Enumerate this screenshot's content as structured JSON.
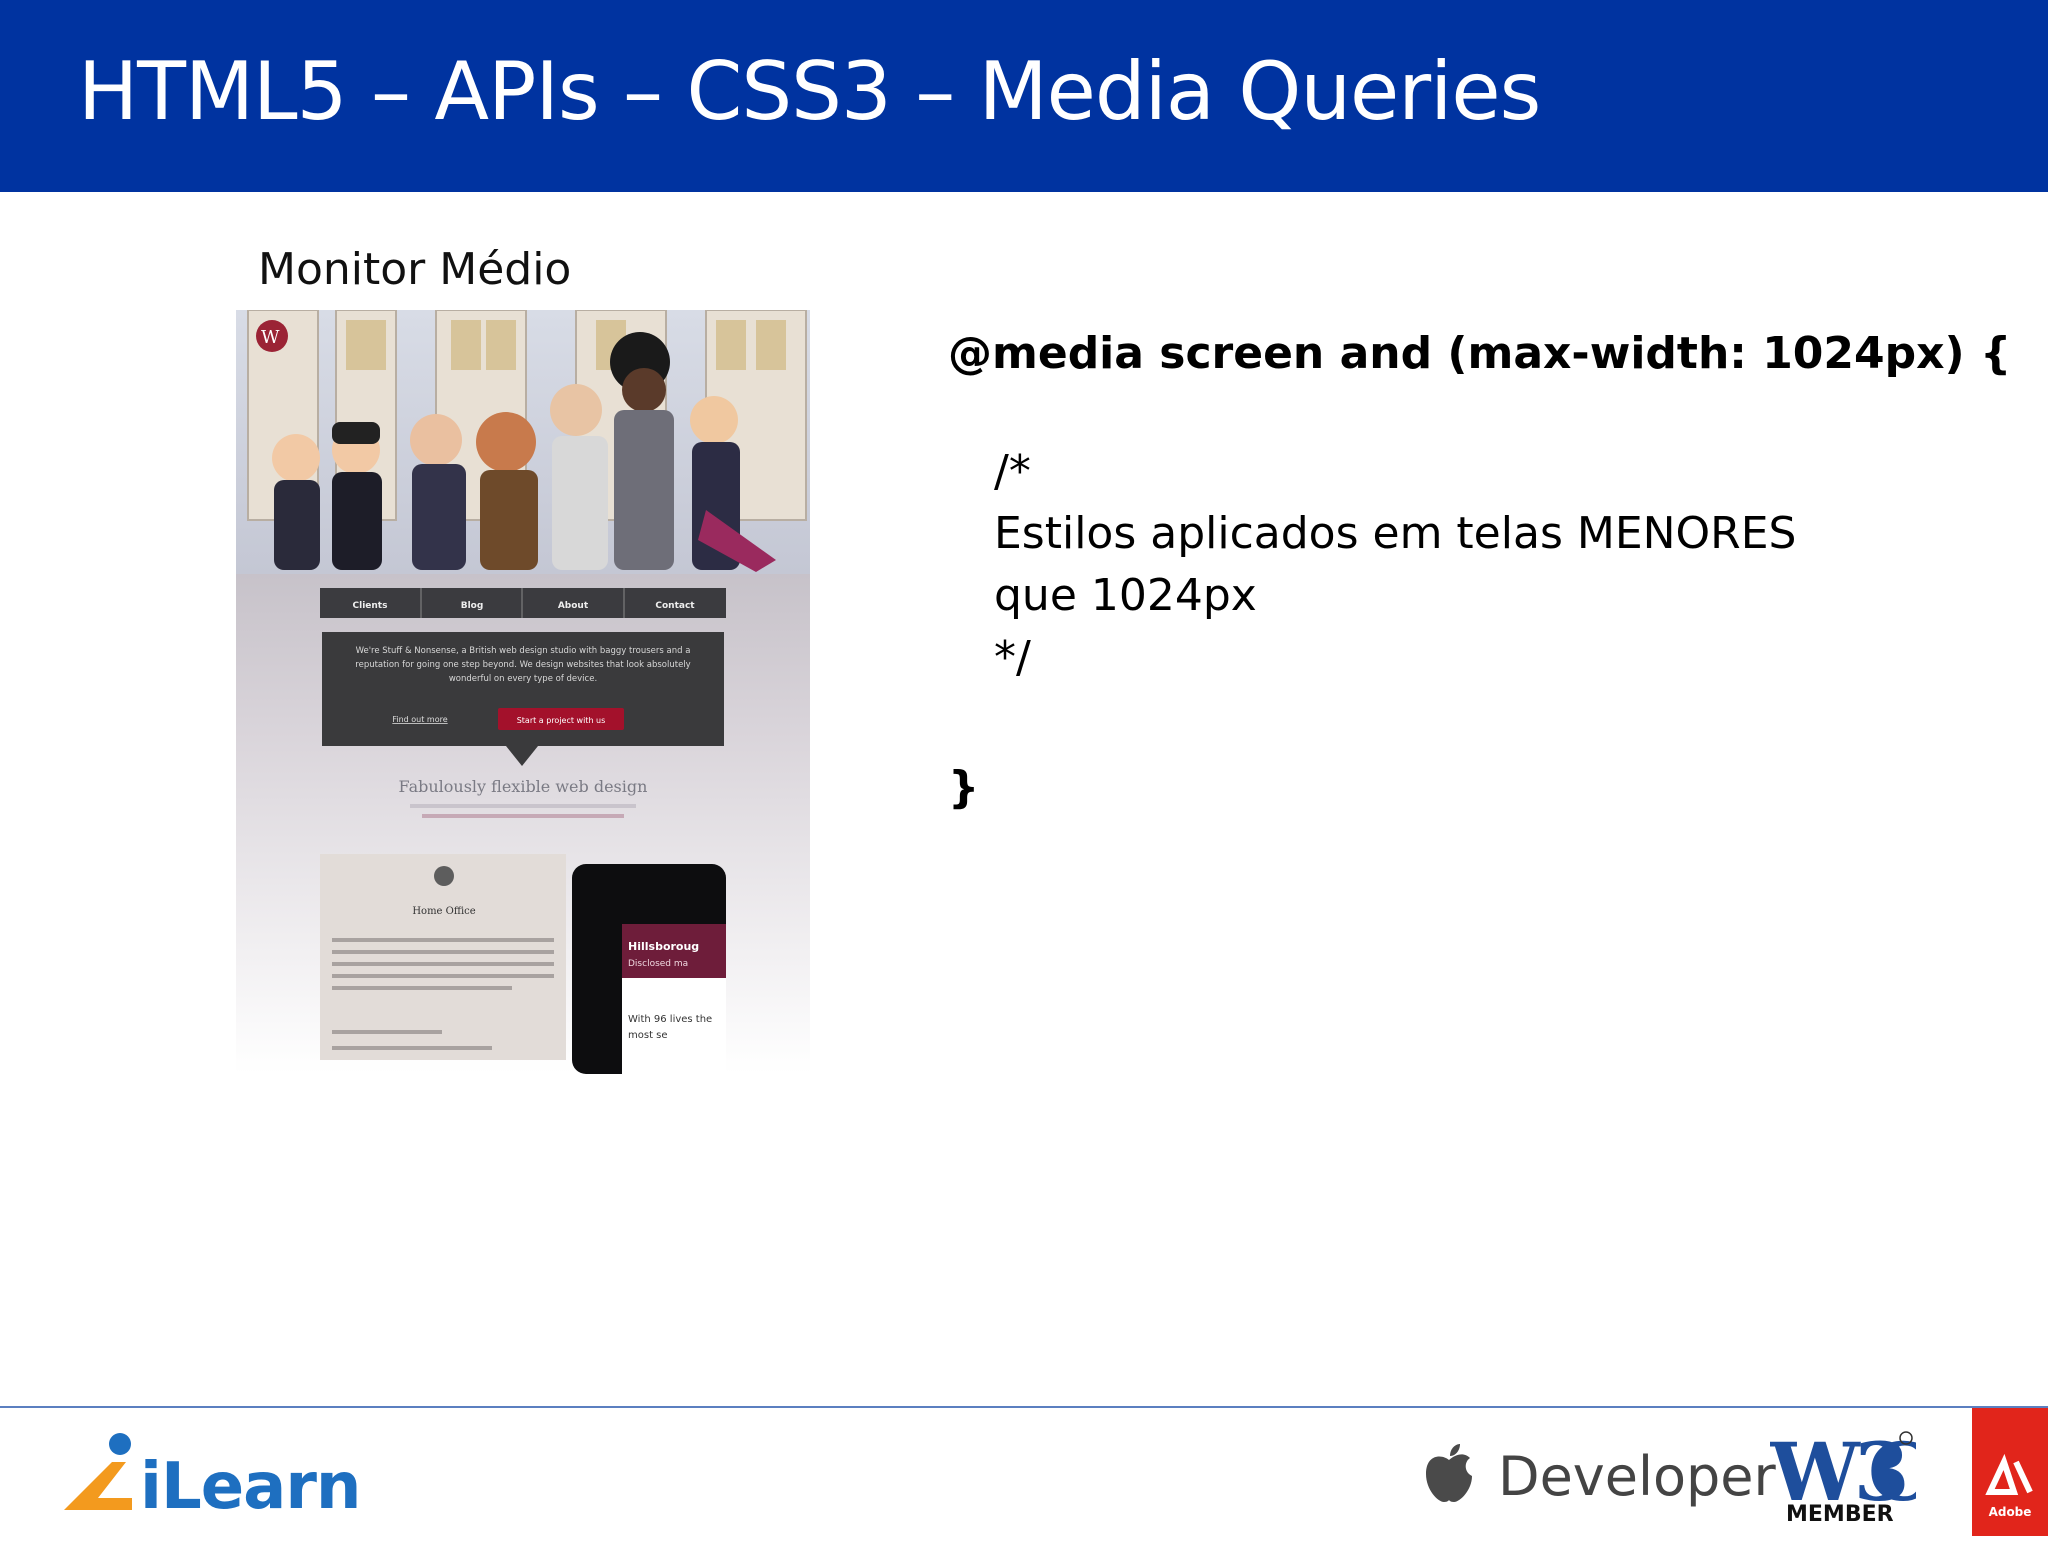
{
  "slide": {
    "title": "HTML5 – APIs – CSS3 – Media Queries",
    "caption": "Monitor Médio"
  },
  "code": {
    "line1": "@media screen and (max-width: 1024px) {",
    "line2": "/*",
    "line3": "Estilos aplicados em telas MENORES",
    "line4": "que 1024px",
    "line5": "*/",
    "line6": "}"
  },
  "screenshot": {
    "nav_items": [
      "Clients",
      "Blog",
      "About",
      "Contact"
    ],
    "intro_text": "We're Stuff & Nonsense, a British web design studio with baggy trousers and a reputation for going one step beyond. We design websites that look absolutely wonderful on every type of device.",
    "find_out_more": "Find out more",
    "cta_button": "Start a project with us",
    "headline": "Fabulously flexible web design",
    "card_title": "Home Office",
    "card_overlay_title": "Hillsboroug",
    "card_overlay_sub": "Disclosed ma",
    "card_body": "With 96 lives the most se"
  },
  "footer": {
    "ilearn": "iLearn",
    "developer": "Developer",
    "w3c_member": "MEMBER",
    "adobe": "Adobe"
  },
  "colors": {
    "header": "#0033a0",
    "ilearn_orange": "#f39a1e",
    "ilearn_blue": "#1e6fc0",
    "adobe_red": "#e1251b"
  }
}
